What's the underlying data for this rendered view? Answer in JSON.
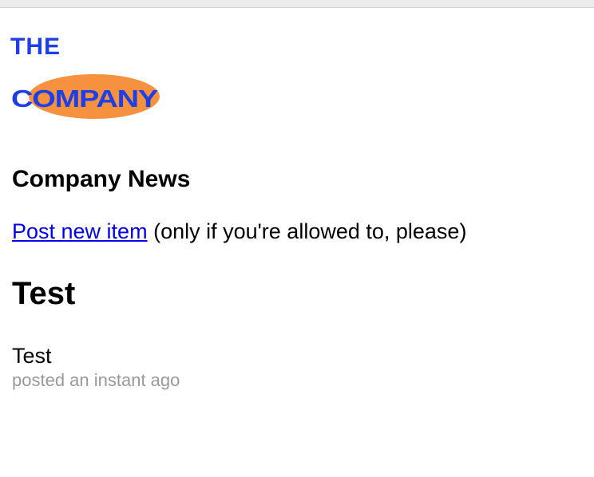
{
  "logo": {
    "line1": "THE",
    "line2": "COMPANY",
    "text_color": "#1f3fe6",
    "ellipse_color": "#f6913f"
  },
  "news": {
    "heading": "Company News",
    "post_link_label": "Post new item",
    "post_note": " (only if you're allowed to, please)"
  },
  "items": [
    {
      "title": "Test",
      "body": "Test",
      "meta": "posted an instant ago"
    }
  ]
}
